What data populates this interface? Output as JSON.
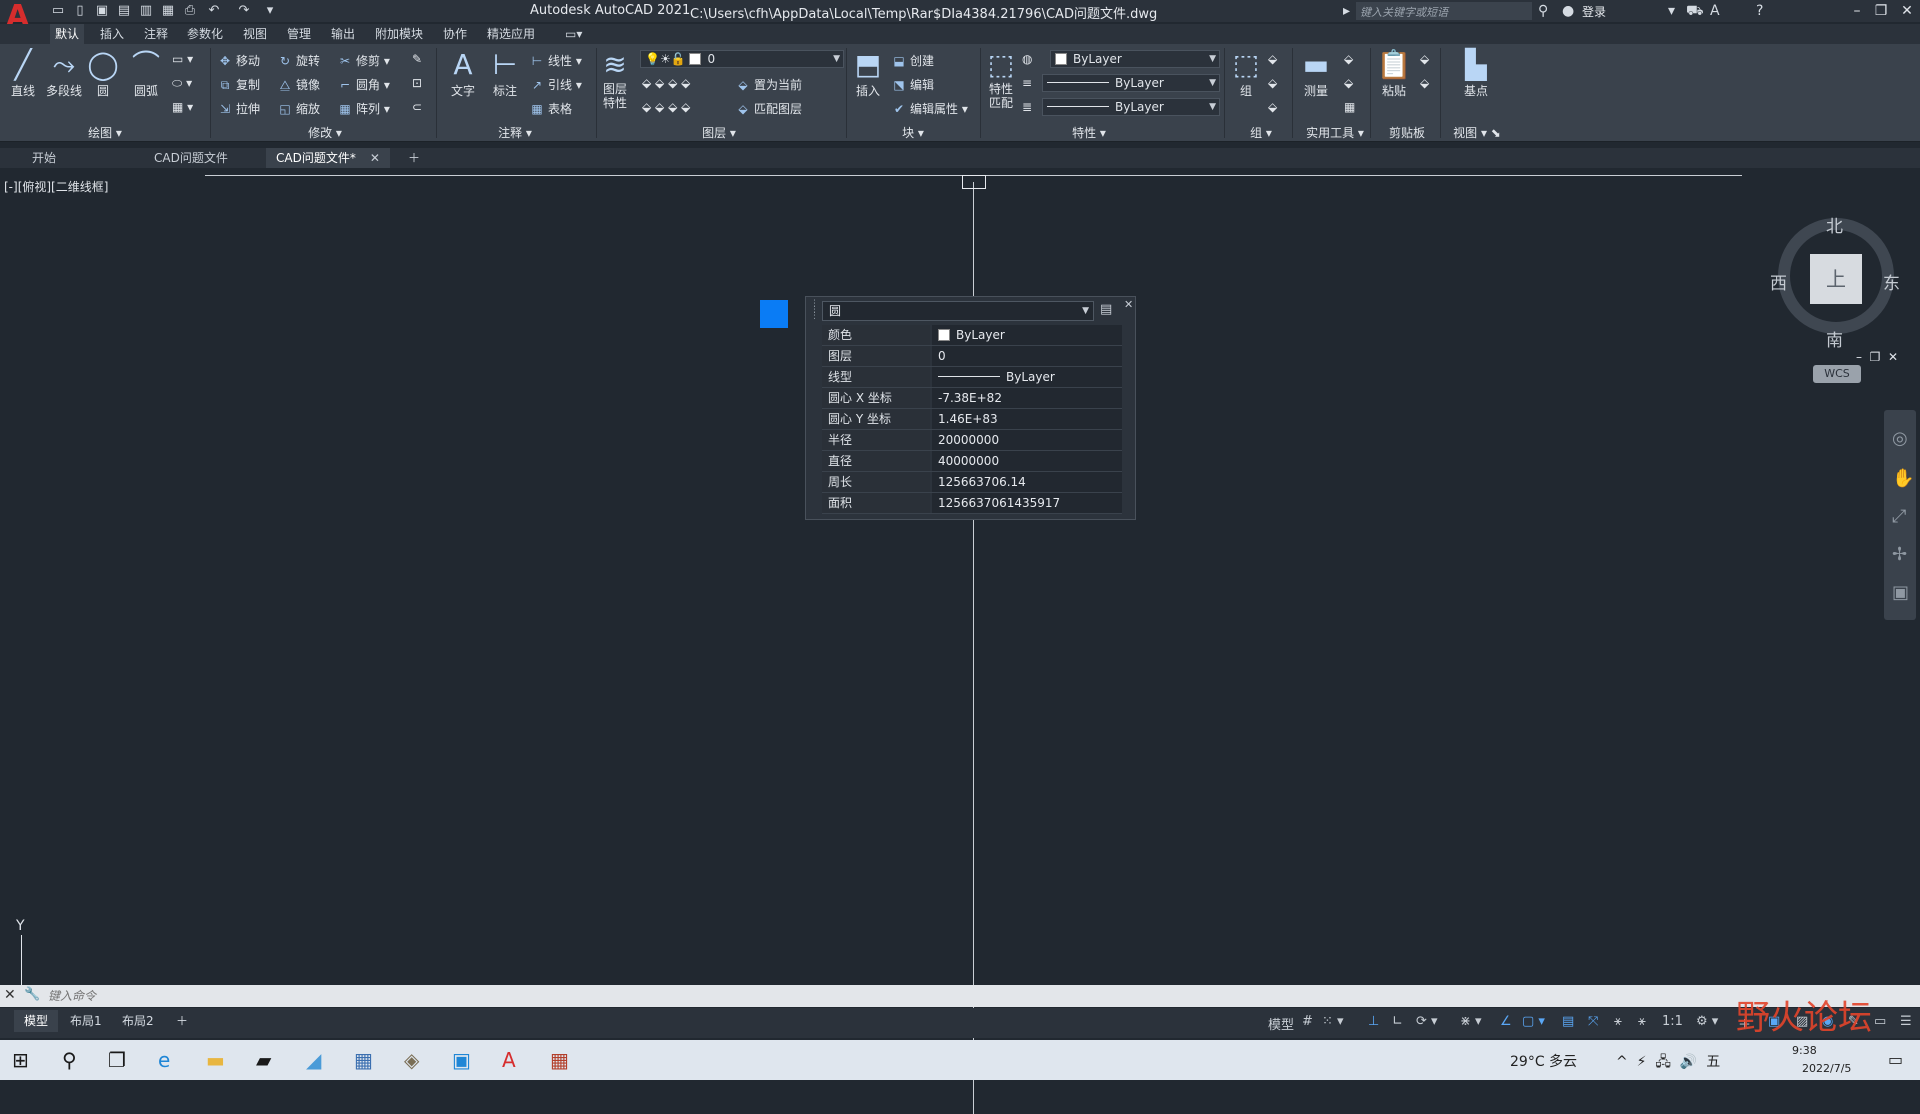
{
  "titlebar": {
    "app_title": "Autodesk AutoCAD 2021",
    "file_path": "C:\\Users\\cfh\\AppData\\Local\\Temp\\Rar$DIa4384.21796\\CAD问题文件.dwg",
    "search_placeholder": "键入关键字或短语",
    "login": "登录"
  },
  "ribbon_tabs": [
    "默认",
    "插入",
    "注释",
    "参数化",
    "视图",
    "管理",
    "输出",
    "附加模块",
    "协作",
    "精选应用"
  ],
  "ribbon": {
    "draw": {
      "title": "绘图",
      "line": "直线",
      "polyline": "多段线",
      "circle": "圆",
      "arc": "圆弧"
    },
    "modify": {
      "title": "修改",
      "move": "移动",
      "rotate": "旋转",
      "trim": "修剪",
      "copy": "复制",
      "mirror": "镜像",
      "fillet": "圆角",
      "stretch": "拉伸",
      "scale": "缩放",
      "array": "阵列"
    },
    "annotation": {
      "title": "注释",
      "text": "文字",
      "dimension": "标注",
      "linear": "线性",
      "leader": "引线",
      "table": "表格"
    },
    "layers": {
      "title": "图层",
      "layer_props": "图层\n特性",
      "layer_value": "0",
      "set_current": "置为当前",
      "match_layer": "匹配图层"
    },
    "block": {
      "title": "块",
      "insert": "插入",
      "create": "创建",
      "edit": "编辑",
      "edit_attr": "编辑属性"
    },
    "properties": {
      "title": "特性",
      "match": "特性\n匹配",
      "color": "ByLayer",
      "lineweight": "ByLayer",
      "linetype": "ByLayer"
    },
    "groups": {
      "title": "组",
      "group": "组"
    },
    "utilities": {
      "title": "实用工具",
      "measure": "测量"
    },
    "clipboard": {
      "title": "剪贴板",
      "paste": "粘贴"
    },
    "view": {
      "title": "视图",
      "base": "基点"
    }
  },
  "doc_tabs": [
    {
      "label": "开始"
    },
    {
      "label": "CAD问题文件*"
    },
    {
      "label": "CAD问题文件*"
    }
  ],
  "viewport": {
    "label": "[-][俯视][二维线框]"
  },
  "quick_properties": {
    "object_type": "圆",
    "rows": [
      {
        "label": "颜色",
        "value": "ByLayer"
      },
      {
        "label": "图层",
        "value": "0"
      },
      {
        "label": "线型",
        "value": "ByLayer"
      },
      {
        "label": "圆心 X 坐标",
        "value": "-7.38E+82"
      },
      {
        "label": "圆心 Y 坐标",
        "value": "1.46E+83"
      },
      {
        "label": "半径",
        "value": "20000000"
      },
      {
        "label": "直径",
        "value": "40000000"
      },
      {
        "label": "周长",
        "value": "125663706.14"
      },
      {
        "label": "面积",
        "value": "1256637061435917"
      }
    ]
  },
  "viewcube": {
    "north": "北",
    "south": "南",
    "east": "东",
    "west": "西",
    "face": "上",
    "wcs": "WCS"
  },
  "ucs": {
    "y": "Y"
  },
  "command": {
    "placeholder": "键入命令"
  },
  "layout_tabs": [
    "模型",
    "布局1",
    "布局2"
  ],
  "status": {
    "model": "模型",
    "scale": "1:1"
  },
  "taskbar": {
    "weather": "29°C 多云",
    "time": "9:38",
    "date": "2022/7/5"
  },
  "watermark": "野火论坛"
}
